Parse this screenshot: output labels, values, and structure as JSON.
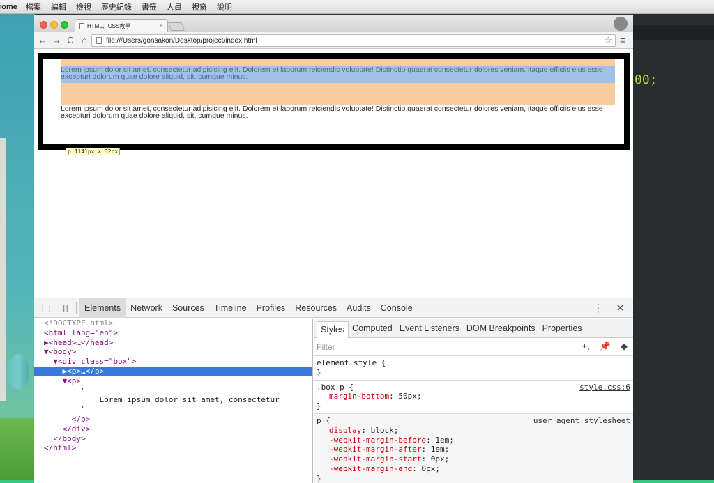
{
  "menubar": {
    "app": "rome",
    "items": [
      "檔案",
      "編輯",
      "檢視",
      "歷史紀錄",
      "書籤",
      "人員",
      "視窗",
      "說明"
    ]
  },
  "editor": {
    "code_snippet": "00;"
  },
  "browser": {
    "tab_title": "HTML、CSS教學",
    "tab_close": "×",
    "url": "file:///Users/gonsakon/Desktop/project/index.html",
    "nav": {
      "back": "←",
      "forward": "→",
      "reload": "C",
      "home": "⌂"
    },
    "star": "☆",
    "menu": "≡"
  },
  "page": {
    "p1": "Lorem ipsum dolor sit amet, consectetur adipisicing elit. Dolorem et laborum reiciendis voluptate! Distinctio quaerat consectetur dolores veniam, itaque officiis eius esse excepturi dolorum quae dolore aliquid, sit, cumque minus.",
    "p2": "Lorem ipsum dolor sit amet, consectetur adipisicing elit. Dolorem et laborum reiciendis voluptate! Distinctio quaerat consectetur dolores veniam, itaque officiis eius esse excepturi dolorum quae dolore aliquid, sit, cumque minus.",
    "tooltip": "p 1141px × 32px"
  },
  "devtools": {
    "tabs": [
      "Elements",
      "Network",
      "Sources",
      "Timeline",
      "Profiles",
      "Resources",
      "Audits",
      "Console"
    ],
    "active_tab": "Elements",
    "dom_lines": [
      "<!DOCTYPE html>",
      "<html lang=\"en\">",
      "▶<head>…</head>",
      "▼<body>",
      "  ▼<div class=\"box\">",
      "    ▶<p>…</p>",
      "    ▼<p>",
      "        \"",
      "            Lorem ipsum dolor sit amet, consectetur",
      "        \"",
      "      </p>",
      "    </div>",
      "  </body>",
      "</html>"
    ],
    "styles_tabs": [
      "Styles",
      "Computed",
      "Event Listeners",
      "DOM Breakpoints",
      "Properties"
    ],
    "filter_placeholder": "Filter",
    "filter_tools": {
      "add": "+,",
      "pin": "📌",
      "toggle": "◆"
    },
    "rules": {
      "element_style": {
        "selector": "element.style {",
        "close": "}"
      },
      "box_p": {
        "selector": ".box p {",
        "source": "style.css:6",
        "prop": "margin-bottom",
        "value": "50px;",
        "close": "}"
      },
      "ua_p": {
        "selector": "p {",
        "source": "user agent stylesheet",
        "props": [
          {
            "name": "display",
            "value": "block;"
          },
          {
            "name": "-webkit-margin-before",
            "value": "1em;"
          },
          {
            "name": "-webkit-margin-after",
            "value": "1em;"
          },
          {
            "name": "-webkit-margin-start",
            "value": "0px;"
          },
          {
            "name": "-webkit-margin-end",
            "value": "0px;"
          }
        ],
        "close": "}"
      }
    }
  }
}
